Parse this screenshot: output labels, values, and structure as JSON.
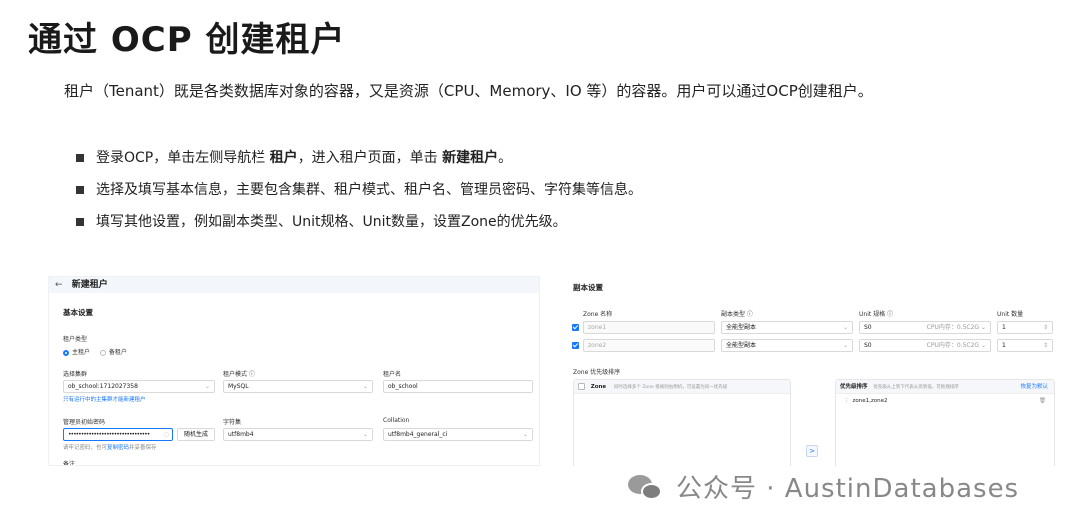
{
  "slide": {
    "title": "通过 OCP 创建租户",
    "intro": "租户（Tenant）既是各类数据库对象的容器，又是资源（CPU、Memory、IO 等）的容器。用户可以通过OCP创建租户。",
    "bullets": [
      {
        "pre": "登录OCP，单击左侧导航栏 ",
        "b1": "租户",
        "mid": "，进入租户页面，单击 ",
        "b2": "新建租户",
        "post": "。"
      },
      {
        "text": "选择及填写基本信息，主要包含集群、租户模式、租户名、管理员密码、字符集等信息。"
      },
      {
        "text": "填写其他设置，例如副本类型、Unit规格、Unit数量，设置Zone的优先级。"
      }
    ]
  },
  "left_panel": {
    "page_title": "新建租户",
    "section": "基本设置",
    "tenant_type_label": "租户类型",
    "tenant_type_options": [
      "主租户",
      "备租户"
    ],
    "cluster_label": "选择集群",
    "cluster_value": "ob_school:1712027358",
    "cluster_hint_link": "只有运行中的主集群才能新建租户",
    "mode_label": "租户模式 ⓘ",
    "mode_value": "MySQL",
    "name_label": "租户名",
    "name_value": "ob_school",
    "password_label": "管理员初始密码",
    "password_value": "••••••••••••••••••••••••••••••••",
    "random_button": "随机生成",
    "password_hint_pre": "请牢记密码，也可",
    "password_hint_link": "复制密码",
    "password_hint_post": "并妥善保存",
    "charset_label": "字符集",
    "charset_value": "utf8mb4",
    "collation_label": "Collation",
    "collation_value": "utf8mb4_general_ci",
    "remark_label": "备注"
  },
  "right_panel": {
    "section": "副本设置",
    "headers": {
      "zone": "Zone 名称",
      "replica": "副本类型 ⓘ",
      "unit_spec": "Unit 规格 ⓘ",
      "unit_count": "Unit 数量"
    },
    "rows": [
      {
        "zone": "zone1",
        "replica": "全能型副本",
        "spec": "S0",
        "spec_detail": "CPU内存：0.5C2G",
        "count": "1"
      },
      {
        "zone": "zone2",
        "replica": "全能型副本",
        "spec": "S0",
        "spec_detail": "CPU内存：0.5C2G",
        "count": "1"
      }
    ],
    "priority_title": "Zone 优先级排序",
    "left_box_label": "Zone",
    "left_box_hint": "同时选择多个 Zone 接被则右侧机，可设置为同一优先级",
    "right_box_title": "优先级排序",
    "right_box_hint": "优先级从上到下代表从高到低，可拖拽排序",
    "reset_link": "恢复为默认",
    "priority_item": "zone1,zone2",
    "transfer_arrow": ">"
  },
  "watermark": {
    "text": "公众号 · AustinDatabases"
  },
  "colors": {
    "accent": "#1677ff"
  }
}
